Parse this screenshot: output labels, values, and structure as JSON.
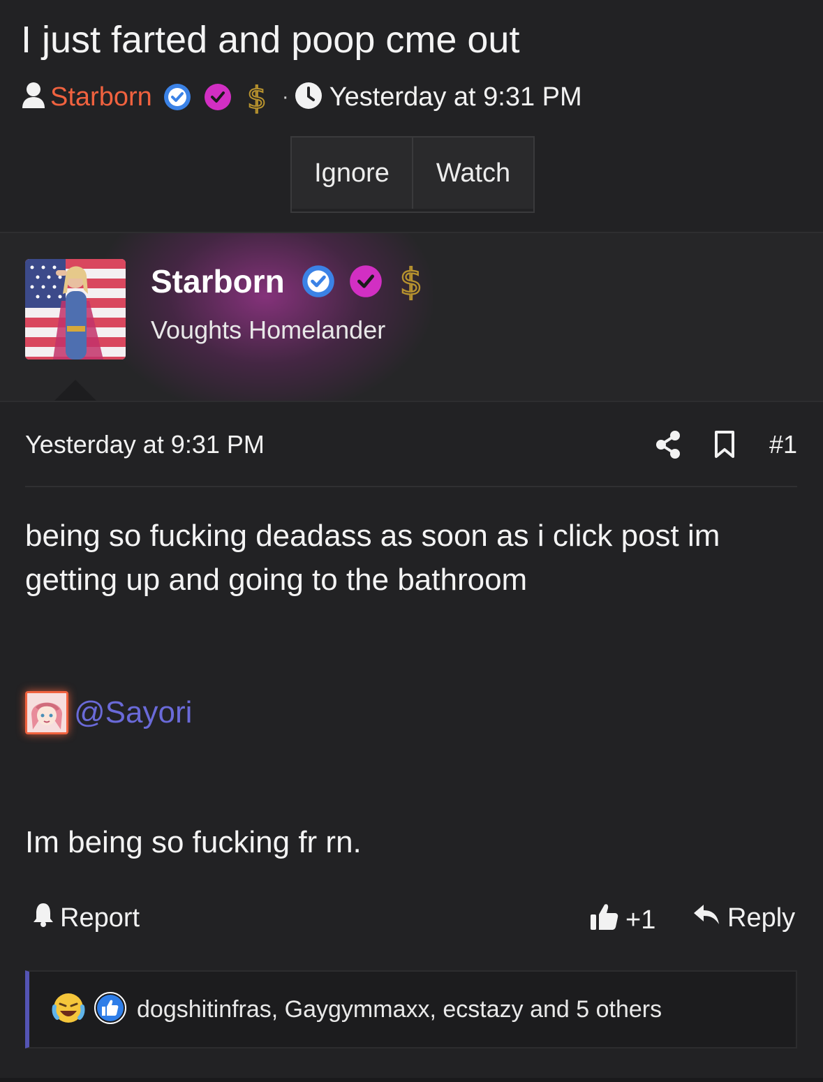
{
  "thread": {
    "title": "I just farted and poop cme out",
    "author": "Starborn",
    "separator": "·",
    "time": "Yesterday at 9:31 PM",
    "buttons": {
      "ignore": "Ignore",
      "watch": "Watch"
    }
  },
  "author_card": {
    "name": "Starborn",
    "user_title": "Voughts Homelander",
    "badges": [
      "verified-blue-icon",
      "verified-pink-icon",
      "dollar-icon"
    ]
  },
  "post": {
    "time": "Yesterday at 9:31 PM",
    "number": "#1",
    "body_line1": "being so fucking deadass as soon as i click post im getting up and going to the bathroom",
    "mention": "@Sayori",
    "body_line2": "Im being so fucking fr rn.",
    "actions": {
      "report": "Report",
      "like_count": "+1",
      "reply": "Reply"
    },
    "reactions": {
      "icons": [
        "laughing-crying-emoji-icon",
        "thumbs-up-reaction-icon"
      ],
      "text": "dogshitinfras, Gaygymmaxx, ecstazy and 5 others"
    }
  },
  "colors": {
    "background": "#222224",
    "username": "#f0623f",
    "mention": "#6a6ad8",
    "badge_blue": "#3b82e6",
    "badge_pink": "#d22fc3",
    "dollar_gold": "#b8932e",
    "reaction_bar": "#5454b4"
  }
}
